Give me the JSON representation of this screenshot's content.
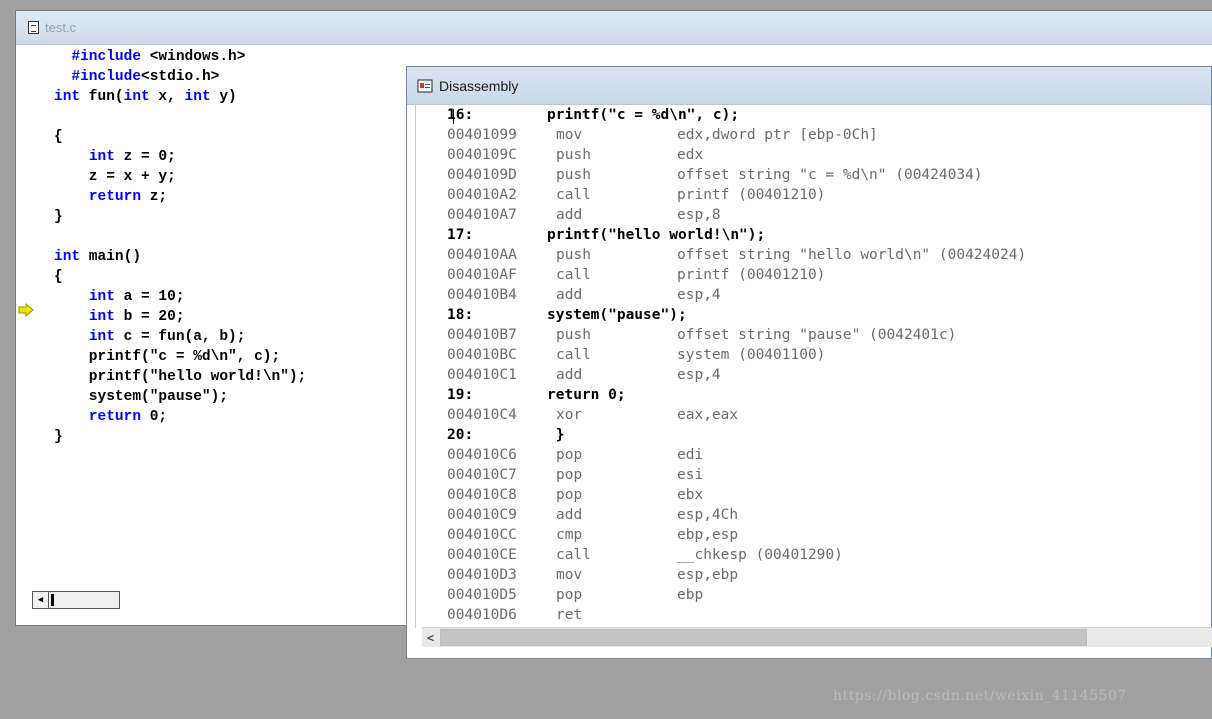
{
  "source_window": {
    "title": "test.c",
    "lines": [
      {
        "parts": [
          {
            "t": "  "
          },
          {
            "t": "#include",
            "k": true
          },
          {
            "t": " <windows.h>"
          }
        ]
      },
      {
        "parts": [
          {
            "t": "  "
          },
          {
            "t": "#include",
            "k": true
          },
          {
            "t": "<stdio.h>"
          }
        ]
      },
      {
        "parts": [
          {
            "t": "int",
            "k": true
          },
          {
            "t": " fun("
          },
          {
            "t": "int",
            "k": true
          },
          {
            "t": " x, "
          },
          {
            "t": "int",
            "k": true
          },
          {
            "t": " y)"
          }
        ]
      },
      {
        "parts": [
          {
            "t": ""
          }
        ]
      },
      {
        "parts": [
          {
            "t": "{"
          }
        ]
      },
      {
        "parts": [
          {
            "t": "    "
          },
          {
            "t": "int",
            "k": true
          },
          {
            "t": " z = 0;"
          }
        ]
      },
      {
        "parts": [
          {
            "t": "    z = x + y;"
          }
        ]
      },
      {
        "parts": [
          {
            "t": "    "
          },
          {
            "t": "return",
            "k": true
          },
          {
            "t": " z;"
          }
        ]
      },
      {
        "parts": [
          {
            "t": "}"
          }
        ]
      },
      {
        "parts": [
          {
            "t": ""
          }
        ]
      },
      {
        "parts": [
          {
            "t": "int",
            "k": true
          },
          {
            "t": " main()"
          }
        ]
      },
      {
        "parts": [
          {
            "t": "{"
          }
        ]
      },
      {
        "parts": [
          {
            "t": "    "
          },
          {
            "t": "int",
            "k": true
          },
          {
            "t": " a = 10;"
          }
        ]
      },
      {
        "parts": [
          {
            "t": "    "
          },
          {
            "t": "int",
            "k": true
          },
          {
            "t": " b = 20;"
          }
        ]
      },
      {
        "parts": [
          {
            "t": "    "
          },
          {
            "t": "int",
            "k": true
          },
          {
            "t": " c = fun(a, b);"
          }
        ]
      },
      {
        "parts": [
          {
            "t": "    printf(\"c = %d\\n\", c);"
          }
        ]
      },
      {
        "parts": [
          {
            "t": "    printf(\"hello world!\\n\");"
          }
        ]
      },
      {
        "parts": [
          {
            "t": "    system(\"pause\");"
          }
        ]
      },
      {
        "parts": [
          {
            "t": "    "
          },
          {
            "t": "return",
            "k": true
          },
          {
            "t": " 0;"
          }
        ]
      },
      {
        "parts": [
          {
            "t": "}"
          }
        ]
      }
    ],
    "current_line_marker": "arrow-icon"
  },
  "disassembly_window": {
    "title": "Disassembly",
    "rows": [
      {
        "type": "src",
        "num": "16:",
        "code": "printf(\"c = %d\\n\", c);"
      },
      {
        "type": "asm",
        "addr": "00401099",
        "mn": "mov",
        "op": "edx,dword ptr [ebp-0Ch]"
      },
      {
        "type": "asm",
        "addr": "0040109C",
        "mn": "push",
        "op": "edx"
      },
      {
        "type": "asm",
        "addr": "0040109D",
        "mn": "push",
        "op": "offset string \"c = %d\\n\" (00424034)"
      },
      {
        "type": "asm",
        "addr": "004010A2",
        "mn": "call",
        "op": "printf (00401210)"
      },
      {
        "type": "asm",
        "addr": "004010A7",
        "mn": "add",
        "op": "esp,8"
      },
      {
        "type": "src",
        "num": "17:",
        "code": "printf(\"hello world!\\n\");"
      },
      {
        "type": "asm",
        "addr": "004010AA",
        "mn": "push",
        "op": "offset string \"hello world\\n\" (00424024)"
      },
      {
        "type": "asm",
        "addr": "004010AF",
        "mn": "call",
        "op": "printf (00401210)"
      },
      {
        "type": "asm",
        "addr": "004010B4",
        "mn": "add",
        "op": "esp,4"
      },
      {
        "type": "src",
        "num": "18:",
        "code": "system(\"pause\");"
      },
      {
        "type": "asm",
        "addr": "004010B7",
        "mn": "push",
        "op": "offset string \"pause\" (0042401c)"
      },
      {
        "type": "asm",
        "addr": "004010BC",
        "mn": "call",
        "op": "system (00401100)"
      },
      {
        "type": "asm",
        "addr": "004010C1",
        "mn": "add",
        "op": "esp,4"
      },
      {
        "type": "src",
        "num": "19:",
        "code": "return 0;"
      },
      {
        "type": "asm",
        "addr": "004010C4",
        "mn": "xor",
        "op": "eax,eax"
      },
      {
        "type": "src",
        "num": "20:",
        "code": " }"
      },
      {
        "type": "asm",
        "addr": "004010C6",
        "mn": "pop",
        "op": "edi"
      },
      {
        "type": "asm",
        "addr": "004010C7",
        "mn": "pop",
        "op": "esi"
      },
      {
        "type": "asm",
        "addr": "004010C8",
        "mn": "pop",
        "op": "ebx"
      },
      {
        "type": "asm",
        "addr": "004010C9",
        "mn": "add",
        "op": "esp,4Ch"
      },
      {
        "type": "asm",
        "addr": "004010CC",
        "mn": "cmp",
        "op": "ebp,esp"
      },
      {
        "type": "asm",
        "addr": "004010CE",
        "mn": "call",
        "op": "__chkesp (00401290)"
      },
      {
        "type": "asm",
        "addr": "004010D3",
        "mn": "mov",
        "op": "esp,ebp"
      },
      {
        "type": "asm",
        "addr": "004010D5",
        "mn": "pop",
        "op": "ebp"
      },
      {
        "type": "asm",
        "addr": "004010D6",
        "mn": "ret",
        "op": ""
      }
    ]
  },
  "scroll": {
    "left_arrow": "<",
    "left_arrow_icon": "scroll-left-icon"
  },
  "watermark": "https://blog.csdn.net/weixin_41145507",
  "colors": {
    "keyword": "#0000ff",
    "asm_text": "#6a6a6a",
    "marker": "#f0e000"
  }
}
